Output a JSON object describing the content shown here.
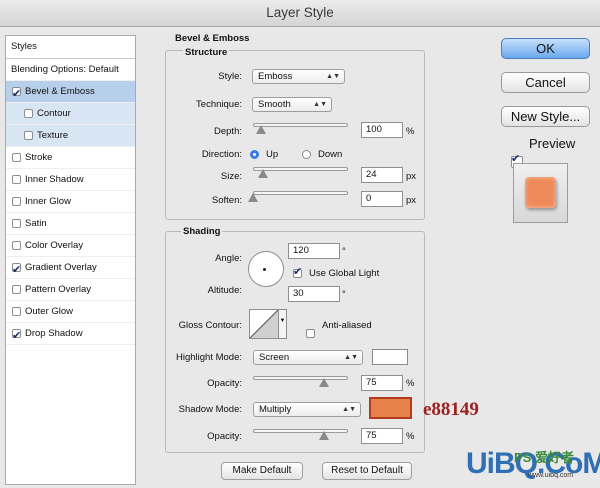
{
  "window": {
    "title": "Layer Style"
  },
  "styles_panel": {
    "header": "Styles",
    "items": [
      {
        "label": "Blending Options: Default",
        "checkbox": false,
        "checked": false
      },
      {
        "label": "Bevel & Emboss",
        "checkbox": true,
        "checked": true
      },
      {
        "label": "Contour",
        "checkbox": true,
        "checked": false
      },
      {
        "label": "Texture",
        "checkbox": true,
        "checked": false
      },
      {
        "label": "Stroke",
        "checkbox": true,
        "checked": false
      },
      {
        "label": "Inner Shadow",
        "checkbox": true,
        "checked": false
      },
      {
        "label": "Inner Glow",
        "checkbox": true,
        "checked": false
      },
      {
        "label": "Satin",
        "checkbox": true,
        "checked": false
      },
      {
        "label": "Color Overlay",
        "checkbox": true,
        "checked": false
      },
      {
        "label": "Gradient Overlay",
        "checkbox": true,
        "checked": true
      },
      {
        "label": "Pattern Overlay",
        "checkbox": true,
        "checked": false
      },
      {
        "label": "Outer Glow",
        "checkbox": true,
        "checked": false
      },
      {
        "label": "Drop Shadow",
        "checkbox": true,
        "checked": true
      }
    ]
  },
  "bevel_emboss": {
    "title": "Bevel & Emboss",
    "structure": {
      "title": "Structure",
      "style_label": "Style:",
      "style_value": "Emboss",
      "technique_label": "Technique:",
      "technique_value": "Smooth",
      "depth_label": "Depth:",
      "depth_value": "100",
      "depth_unit": "%",
      "direction_label": "Direction:",
      "direction_up": "Up",
      "direction_down": "Down",
      "direction_selected": "Up",
      "size_label": "Size:",
      "size_value": "24",
      "size_unit": "px",
      "soften_label": "Soften:",
      "soften_value": "0",
      "soften_unit": "px"
    },
    "shading": {
      "title": "Shading",
      "angle_label": "Angle:",
      "angle_value": "120",
      "angle_unit": "°",
      "global_light_label": "Use Global Light",
      "global_light_checked": true,
      "altitude_label": "Altitude:",
      "altitude_value": "30",
      "altitude_unit": "°",
      "gloss_contour_label": "Gloss Contour:",
      "anti_aliased_label": "Anti-aliased",
      "anti_aliased_checked": false,
      "highlight_mode_label": "Highlight Mode:",
      "highlight_mode_value": "Screen",
      "highlight_color": "#ffffff",
      "highlight_opacity_label": "Opacity:",
      "highlight_opacity_value": "75",
      "highlight_opacity_unit": "%",
      "shadow_mode_label": "Shadow Mode:",
      "shadow_mode_value": "Multiply",
      "shadow_color": "#e88149",
      "shadow_opacity_label": "Opacity:",
      "shadow_opacity_value": "75",
      "shadow_opacity_unit": "%"
    },
    "make_default_button": "Make Default",
    "reset_default_button": "Reset to Default"
  },
  "sliders": {
    "depth": 0.08,
    "size": 0.11,
    "soften": 0.0,
    "highlight_opacity": 0.75,
    "shadow_opacity": 0.75
  },
  "right_panel": {
    "ok_button": "OK",
    "cancel_button": "Cancel",
    "new_style_button": "New Style...",
    "preview_label": "Preview",
    "preview_checked": true,
    "preview_color": "#ef8a5a"
  },
  "annotation": {
    "color_code": "e88149",
    "color": "#9c1f1f"
  },
  "watermark": {
    "brand": "UiBQ.CoM",
    "site_chars": "PS 爱好者",
    "url": "www.uibq.com"
  }
}
